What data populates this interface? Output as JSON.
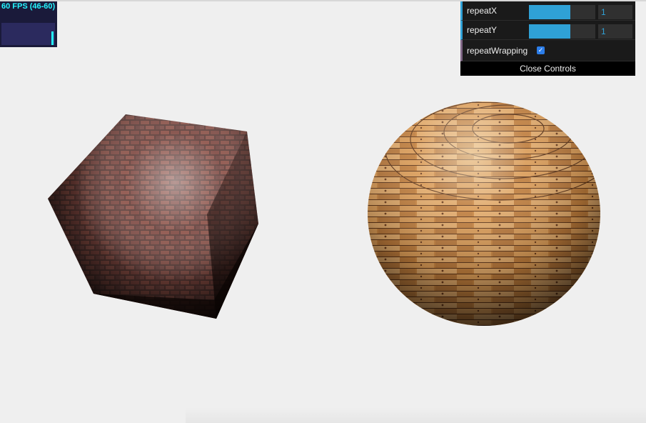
{
  "stats": {
    "fps_text": "60 FPS (46-60)",
    "bar_level": 0.6
  },
  "gui": {
    "controls": [
      {
        "label": "repeatX",
        "value": "1",
        "slider_fill": 0.62
      },
      {
        "label": "repeatY",
        "value": "1",
        "slider_fill": 0.62
      }
    ],
    "toggle": {
      "label": "repeatWrapping",
      "checked": true
    },
    "close_label": "Close Controls"
  },
  "colors": {
    "background": "#efefef",
    "gui_accent": "#2fa1d6",
    "stats_text": "#25f6ff"
  }
}
